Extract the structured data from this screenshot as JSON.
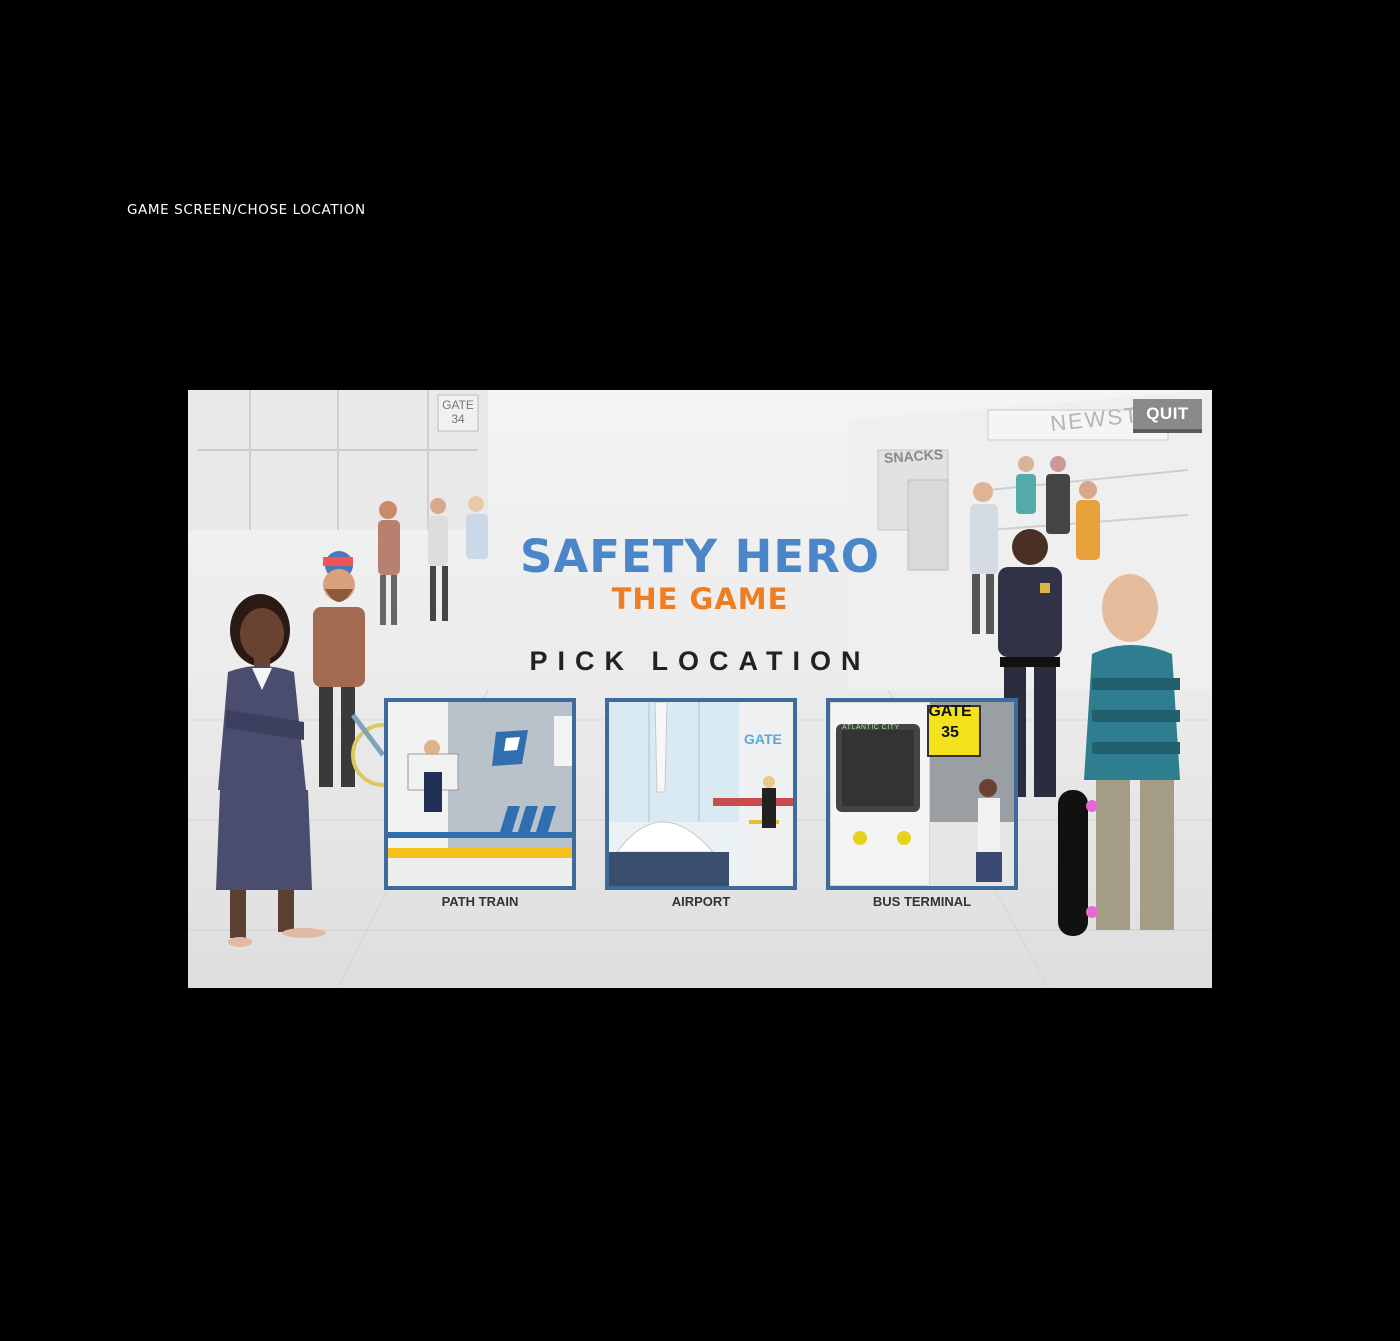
{
  "caption": "GAME SCREEN/CHOSE LOCATION",
  "game": {
    "quit_label": "QUIT",
    "title_line1": "SAFETY HERO",
    "title_line2": "THE GAME",
    "pick_label": "PICK LOCATION",
    "background_signs": {
      "gate_left": "GATE 34",
      "snacks": "SNACKS",
      "newsstand": "NEWSTAND"
    },
    "locations": [
      {
        "label": "PATH TRAIN"
      },
      {
        "label": "AIRPORT",
        "sign": "GATE"
      },
      {
        "label": "BUS TERMINAL",
        "sign_line1": "GATE",
        "sign_line2": "35",
        "destination": "ATLANTIC CITY"
      }
    ]
  },
  "colors": {
    "title_blue": "#4a86c8",
    "title_orange": "#ef7d22",
    "card_border": "#3e6a9c",
    "quit_bg": "#8a8a8a"
  }
}
